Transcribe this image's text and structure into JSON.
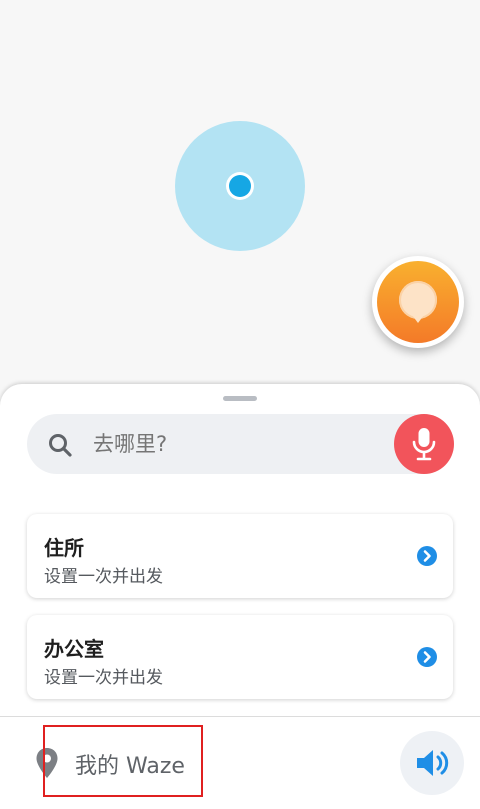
{
  "map": {
    "accuracy_color": "#b3e3f3",
    "location_color": "#16a7e4"
  },
  "report_button": {
    "icon": "report-bubble-icon",
    "color": "#f7962b"
  },
  "search": {
    "placeholder": "去哪里?",
    "icon": "search-icon",
    "mic_icon": "microphone-icon",
    "mic_color": "#f2545b"
  },
  "favorites": [
    {
      "title": "住所",
      "subtitle": "设置一次并出发",
      "icon": "chevron-right-icon"
    },
    {
      "title": "办公室",
      "subtitle": "设置一次并出发",
      "icon": "chevron-right-icon"
    }
  ],
  "bottom_bar": {
    "my_waze_label": "我的 Waze",
    "my_waze_icon": "location-pin-icon",
    "sound_icon": "speaker-icon",
    "accent": "#1f8ee6"
  }
}
